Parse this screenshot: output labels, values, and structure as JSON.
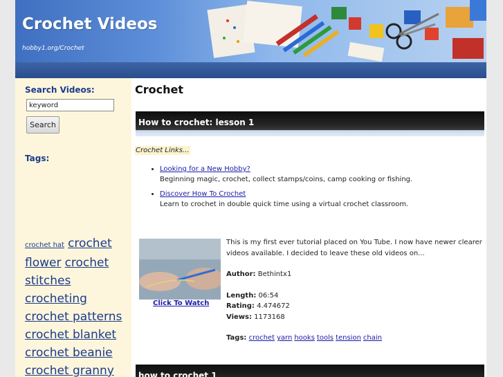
{
  "site": {
    "title": "Crochet Videos",
    "url": "hobby1.org/Crochet"
  },
  "sidebar": {
    "search_heading": "Search Videos:",
    "search_value": "keyword",
    "search_button": "Search",
    "tags_heading": "Tags:",
    "tags": [
      "crochet hat",
      "crochet flower",
      "crochet stitches",
      "crocheting",
      "crochet patterns",
      "crochet blanket",
      "crochet beanie",
      "crochet granny"
    ]
  },
  "main": {
    "page_title": "Crochet",
    "videos": [
      {
        "title": "How to crochet: lesson 1",
        "click_to_watch": "Click To Watch",
        "description": "This is my first ever tutorial placed on You Tube. I now have newer clearer videos available. I decided to leave these old videos on...",
        "author_label": "Author:",
        "author": "Bethintx1",
        "length_label": "Length:",
        "length": "06:54",
        "rating_label": "Rating:",
        "rating": "4.474672",
        "views_label": "Views:",
        "views": "1173168",
        "tags_label": "Tags:",
        "tags": [
          "crochet",
          "yarn",
          "hooks",
          "tools",
          "tension",
          "chain"
        ]
      },
      {
        "title": "how to crochet 1"
      }
    ],
    "links": {
      "heading": "Crochet Links...",
      "items": [
        {
          "title": "Looking for a New Hobby?",
          "description": "Beginning magic, crochet, collect stamps/coins, camp cooking or fishing."
        },
        {
          "title": "Discover How To Crochet",
          "description": "Learn to crochet in double quick time using a virtual crochet classroom."
        }
      ]
    }
  },
  "colors": {
    "header_blue": "#2a4d8c",
    "sidebar_bg": "#fdf6dc",
    "heading_blue": "#1b3b8c",
    "link_blue": "#1a1aa6"
  }
}
